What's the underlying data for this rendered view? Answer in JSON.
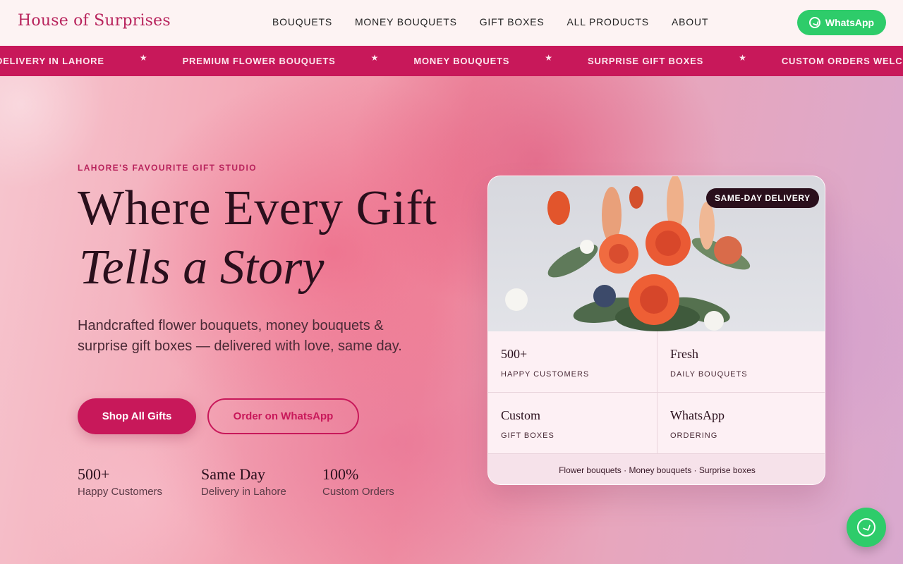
{
  "header": {
    "logo": "House of Surprises",
    "nav": [
      "BOUQUETS",
      "MONEY BOUQUETS",
      "GIFT BOXES",
      "ALL PRODUCTS",
      "ABOUT"
    ],
    "whatsapp_label": "WhatsApp"
  },
  "marquee": {
    "items": [
      "DELIVERY IN LAHORE",
      "PREMIUM FLOWER BOUQUETS",
      "MONEY BOUQUETS",
      "SURPRISE GIFT BOXES",
      "CUSTOM ORDERS WELCOME"
    ],
    "separator": "★"
  },
  "hero": {
    "eyebrow": "LAHORE'S FAVOURITE GIFT STUDIO",
    "title_line1": "Where Every Gift",
    "title_line2": "Tells a Story",
    "lede": "Handcrafted flower bouquets, money bouquets & surprise gift boxes — delivered with love, same day.",
    "primary_cta": "Shop All Gifts",
    "secondary_cta": "Order on WhatsApp",
    "stats": [
      {
        "value": "500+",
        "label": "Happy Customers"
      },
      {
        "value": "Same Day",
        "label": "Delivery in Lahore"
      },
      {
        "value": "100%",
        "label": "Custom Orders"
      }
    ]
  },
  "card": {
    "badge": "SAME-DAY DELIVERY",
    "cells": [
      {
        "value": "500+",
        "label": "HAPPY CUSTOMERS"
      },
      {
        "value": "Fresh",
        "label": "DAILY BOUQUETS"
      },
      {
        "value": "Custom",
        "label": "GIFT BOXES"
      },
      {
        "value": "WhatsApp",
        "label": "ORDERING"
      }
    ],
    "footer": "Flower bouquets · Money bouquets · Surprise boxes"
  },
  "colors": {
    "brand": "#c8185a",
    "dark": "#2a0f1c",
    "whatsapp": "#2ecc6a"
  },
  "icons": {
    "whatsapp": "whatsapp-icon",
    "fab": "whatsapp-icon"
  }
}
